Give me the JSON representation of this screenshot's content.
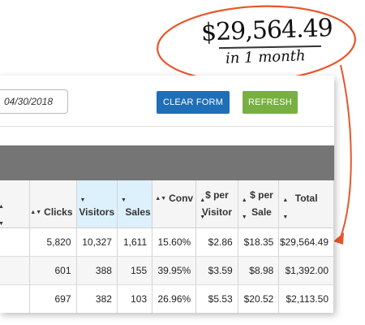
{
  "callout": {
    "amount": "$29,564.49",
    "period": "in 1 month",
    "color": "#e8562a"
  },
  "form": {
    "end_date": "04/30/2018",
    "clear_label": "CLEAR FORM",
    "refresh_label": "REFRESH"
  },
  "table": {
    "columns": [
      {
        "label": "Clicks",
        "sortable": true,
        "highlighted": false
      },
      {
        "label": "Visitors",
        "sortable": true,
        "highlighted": true
      },
      {
        "label": "Sales",
        "sortable": true,
        "highlighted": true
      },
      {
        "label": "Conv",
        "sortable": true,
        "highlighted": false
      },
      {
        "label_line1": "$ per",
        "label_line2": "Visitor",
        "sortable": true,
        "highlighted": false
      },
      {
        "label_line1": "$ per",
        "label_line2": "Sale",
        "sortable": true,
        "highlighted": false
      },
      {
        "label": "Total",
        "sortable": true,
        "highlighted": false
      }
    ],
    "rows": [
      [
        "5,820",
        "10,327",
        "1,611",
        "15.60%",
        "$2.86",
        "$18.35",
        "$29,564.49"
      ],
      [
        "601",
        "388",
        "155",
        "39.95%",
        "$3.59",
        "$8.98",
        "$1,392.00"
      ],
      [
        "697",
        "382",
        "103",
        "26.96%",
        "$5.53",
        "$20.52",
        "$2,113.50"
      ]
    ]
  }
}
